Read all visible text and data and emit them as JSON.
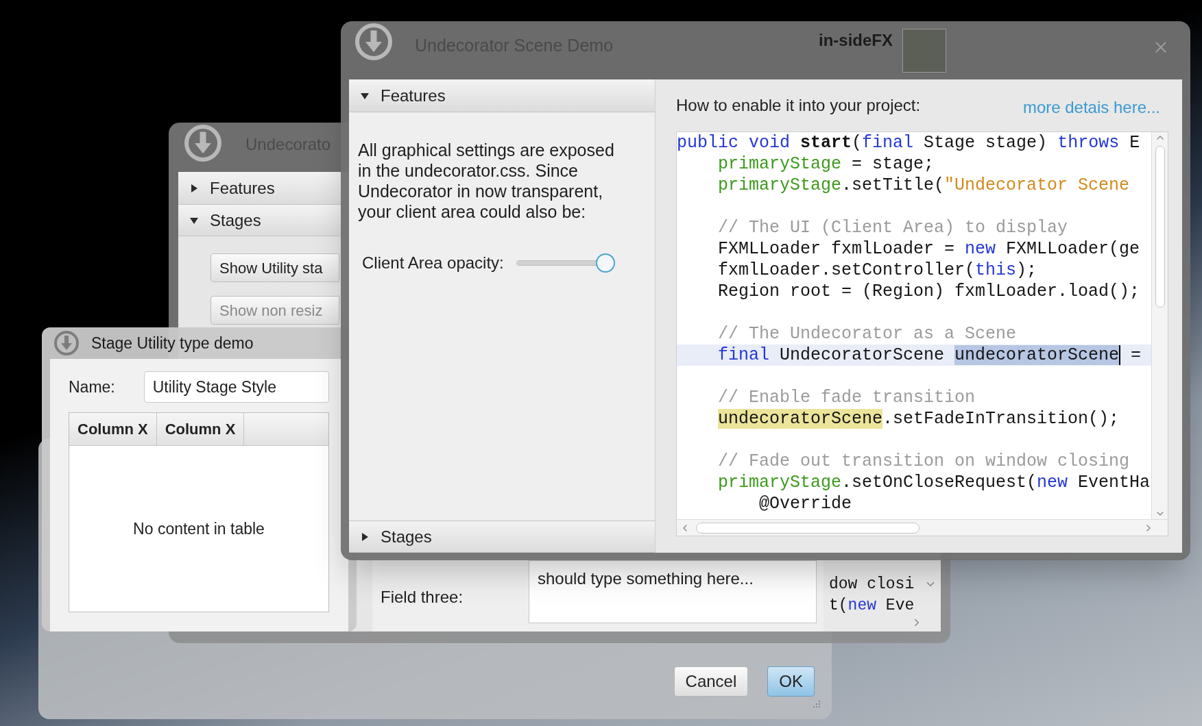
{
  "dialog_window": {
    "buttons": [
      {
        "label": "Cancel",
        "default": false
      },
      {
        "label": "OK",
        "default": true
      }
    ]
  },
  "back_window": {
    "title": "Undecorato",
    "accordion": [
      {
        "label": "Features",
        "expanded": false
      },
      {
        "label": "Stages",
        "expanded": true
      }
    ],
    "buttons": [
      "Show Utility sta",
      "Show non resiz"
    ],
    "field": {
      "label": "Field three:",
      "value": "should type something here..."
    },
    "code_lines": [
      [
        {
          "kind": "plain",
          "text": "dow closi"
        }
      ],
      [
        {
          "kind": "plain",
          "text": "t("
        },
        {
          "kind": "keyword",
          "text": "new"
        },
        {
          "kind": "plain",
          "text": " Eve"
        }
      ]
    ]
  },
  "utility_window": {
    "title": "Stage Utility type demo",
    "name_label": "Name:",
    "name_value": "Utility Stage Style",
    "table": {
      "columns": [
        "Column X",
        "Column X"
      ],
      "empty_text": "No content in table"
    }
  },
  "main_window": {
    "title": "Undecorator Scene Demo",
    "brand": "in-sideFX",
    "accordion": [
      {
        "label": "Features",
        "expanded": true
      },
      {
        "label": "Stages",
        "expanded": false
      }
    ],
    "description": "All graphical settings are exposed in the undecorator.css. Since Undecorator in now transparent, your client area could also be:",
    "slider": {
      "label": "Client Area opacity:",
      "level": 1
    },
    "heading": "How to enable it into your project:",
    "link": "more detais here...",
    "code_lines": [
      {
        "kind": "top",
        "current": false,
        "tokens": [
          {
            "kind": "keyword",
            "text": "public void "
          },
          {
            "kind": "bold",
            "text": "start"
          },
          {
            "kind": "plain",
            "text": "("
          },
          {
            "kind": "keyword",
            "text": "final"
          },
          {
            "kind": "plain",
            "text": " Stage stage) "
          },
          {
            "kind": "keyword",
            "text": "throws"
          },
          {
            "kind": "plain",
            "text": " E"
          }
        ]
      },
      {
        "kind": "body",
        "current": false,
        "tokens": [
          {
            "kind": "field",
            "text": "primaryStage"
          },
          {
            "kind": "plain",
            "text": " = stage;"
          }
        ]
      },
      {
        "kind": "body",
        "current": false,
        "tokens": [
          {
            "kind": "field",
            "text": "primaryStage"
          },
          {
            "kind": "plain",
            "text": ".setTitle("
          },
          {
            "kind": "string",
            "text": "\"Undecorator Scene"
          }
        ]
      },
      {
        "kind": "blank",
        "current": false
      },
      {
        "kind": "body",
        "current": false,
        "tokens": [
          {
            "kind": "comment",
            "text": "// The UI (Client Area) to display"
          }
        ]
      },
      {
        "kind": "body",
        "current": false,
        "tokens": [
          {
            "kind": "plain",
            "text": "FXMLLoader fxmlLoader = "
          },
          {
            "kind": "keyword",
            "text": "new"
          },
          {
            "kind": "plain",
            "text": " FXMLLoader(ge"
          }
        ]
      },
      {
        "kind": "body",
        "current": false,
        "tokens": [
          {
            "kind": "plain",
            "text": "fxmlLoader.setController("
          },
          {
            "kind": "keyword",
            "text": "this"
          },
          {
            "kind": "plain",
            "text": ");"
          }
        ]
      },
      {
        "kind": "body",
        "current": false,
        "tokens": [
          {
            "kind": "plain",
            "text": "Region root = (Region) fxmlLoader.load();"
          }
        ]
      },
      {
        "kind": "blank",
        "current": false
      },
      {
        "kind": "body",
        "current": false,
        "tokens": [
          {
            "kind": "comment",
            "text": "// The Undecorator as a Scene"
          }
        ]
      },
      {
        "kind": "body",
        "current": true,
        "tokens": [
          {
            "kind": "keyword",
            "text": "final"
          },
          {
            "kind": "plain",
            "text": " UndecoratorScene "
          },
          {
            "kind": "selected",
            "text": "undecoratorScene"
          },
          {
            "kind": "plain",
            "text": " ="
          }
        ]
      },
      {
        "kind": "blank",
        "current": false
      },
      {
        "kind": "body",
        "current": false,
        "tokens": [
          {
            "kind": "comment",
            "text": "// Enable fade transition"
          }
        ]
      },
      {
        "kind": "body",
        "current": false,
        "tokens": [
          {
            "kind": "occurrence",
            "text": "undecoratorScene"
          },
          {
            "kind": "plain",
            "text": ".setFadeInTransition();"
          }
        ]
      },
      {
        "kind": "blank",
        "current": false
      },
      {
        "kind": "body",
        "current": false,
        "tokens": [
          {
            "kind": "comment",
            "text": "// Fade out transition on window closing"
          }
        ]
      },
      {
        "kind": "body",
        "current": false,
        "tokens": [
          {
            "kind": "field",
            "text": "primaryStage"
          },
          {
            "kind": "plain",
            "text": ".setOnCloseRequest("
          },
          {
            "kind": "keyword",
            "text": "new"
          },
          {
            "kind": "plain",
            "text": " EventHa"
          }
        ]
      },
      {
        "kind": "nested",
        "current": false,
        "tokens": [
          {
            "kind": "plain",
            "text": "@Override"
          }
        ]
      }
    ]
  }
}
